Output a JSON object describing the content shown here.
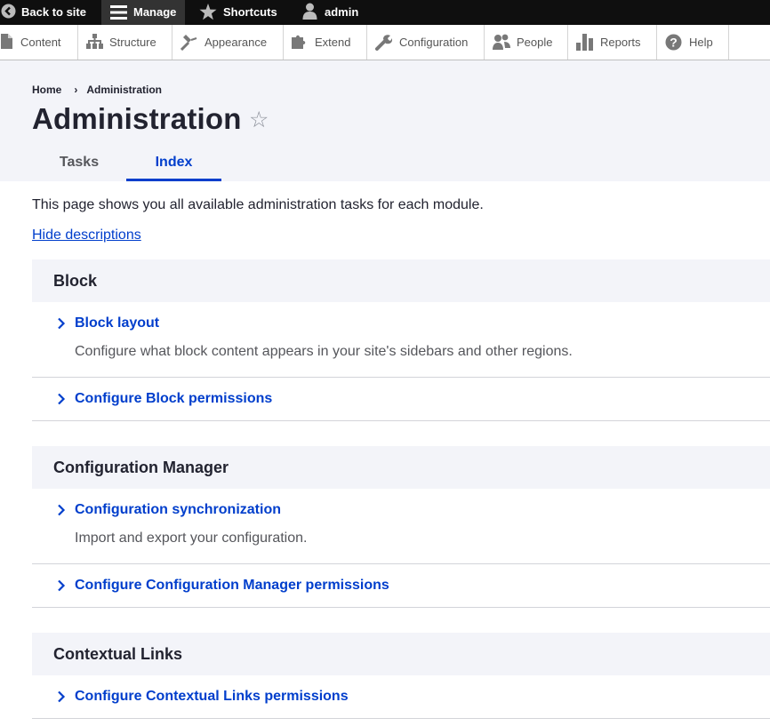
{
  "toolbar": {
    "back_to_site": "Back to site",
    "manage": "Manage",
    "shortcuts": "Shortcuts",
    "user": "admin"
  },
  "tray": {
    "items": [
      {
        "label": "Content",
        "icon": "file-icon"
      },
      {
        "label": "Structure",
        "icon": "sitemap-icon"
      },
      {
        "label": "Appearance",
        "icon": "paint-roller-icon"
      },
      {
        "label": "Extend",
        "icon": "puzzle-icon"
      },
      {
        "label": "Configuration",
        "icon": "wrench-icon"
      },
      {
        "label": "People",
        "icon": "people-icon"
      },
      {
        "label": "Reports",
        "icon": "bar-chart-icon"
      },
      {
        "label": "Help",
        "icon": "help-icon"
      }
    ]
  },
  "breadcrumb": {
    "home": "Home",
    "separator": "›",
    "current": "Administration"
  },
  "page": {
    "title": "Administration",
    "star": "☆"
  },
  "tabs": {
    "tasks": "Tasks",
    "index": "Index",
    "active": "Index"
  },
  "content": {
    "intro": "This page shows you all available administration tasks for each module.",
    "hide_descriptions": "Hide descriptions"
  },
  "sections": [
    {
      "title": "Block",
      "items": [
        {
          "link": "Block layout",
          "description": "Configure what block content appears in your site's sidebars and other regions."
        },
        {
          "link": "Configure Block permissions",
          "description": ""
        }
      ]
    },
    {
      "title": "Configuration Manager",
      "items": [
        {
          "link": "Configuration synchronization",
          "description": "Import and export your configuration."
        },
        {
          "link": "Configure Configuration Manager permissions",
          "description": ""
        }
      ]
    },
    {
      "title": "Contextual Links",
      "items": [
        {
          "link": "Configure Contextual Links permissions",
          "description": ""
        }
      ]
    }
  ],
  "colors": {
    "toolbar_bg": "#0f0f0f",
    "link_blue": "#003ecc",
    "panel_bg": "#f3f4f9",
    "text_dark": "#222330"
  }
}
